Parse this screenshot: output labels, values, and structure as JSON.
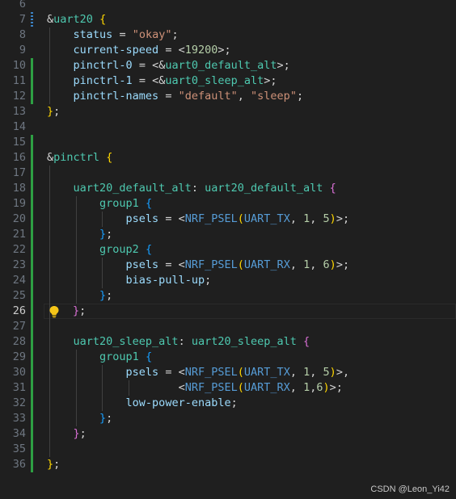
{
  "editor": {
    "active_line": "26",
    "lines": [
      {
        "n": "6",
        "html": ""
      },
      {
        "n": "7",
        "html": "<span class='t-amp'>&amp;</span><span class='t-node'>uart20</span> <span class='t-b1'>{</span>"
      },
      {
        "n": "8",
        "html": "    <span class='t-prop'>status</span> <span class='t-punct'>=</span> <span class='t-str'>\"okay\"</span><span class='t-punct'>;</span>"
      },
      {
        "n": "9",
        "html": "    <span class='t-prop'>current-speed</span> <span class='t-punct'>=</span> <span class='t-punct'>&lt;</span><span class='t-num'>19200</span><span class='t-punct'>&gt;;</span>"
      },
      {
        "n": "10",
        "html": "    <span class='t-prop'>pinctrl-0</span> <span class='t-punct'>= &lt;&amp;</span><span class='t-node'>uart0_default_alt</span><span class='t-punct'>&gt;;</span>"
      },
      {
        "n": "11",
        "html": "    <span class='t-prop'>pinctrl-1</span> <span class='t-punct'>= &lt;&amp;</span><span class='t-node'>uart0_sleep_alt</span><span class='t-punct'>&gt;;</span>"
      },
      {
        "n": "12",
        "html": "    <span class='t-prop'>pinctrl-names</span> <span class='t-punct'>=</span> <span class='t-str'>\"default\"</span><span class='t-punct'>,</span> <span class='t-str'>\"sleep\"</span><span class='t-punct'>;</span>"
      },
      {
        "n": "13",
        "html": "<span class='t-b1'>}</span><span class='t-punct'>;</span>"
      },
      {
        "n": "14",
        "html": ""
      },
      {
        "n": "15",
        "html": ""
      },
      {
        "n": "16",
        "html": "<span class='t-amp'>&amp;</span><span class='t-node'>pinctrl</span> <span class='t-b1'>{</span>"
      },
      {
        "n": "17",
        "html": ""
      },
      {
        "n": "18",
        "html": "    <span class='t-label'>uart20_default_alt</span><span class='t-punct'>:</span> <span class='t-label'>uart20_default_alt</span> <span class='t-b2'>{</span>"
      },
      {
        "n": "19",
        "html": "        <span class='t-label'>group1</span> <span class='t-b3'>{</span>"
      },
      {
        "n": "20",
        "html": "            <span class='t-prop'>psels</span> <span class='t-punct'>=</span> <span class='t-punct'>&lt;</span><span class='t-macro'>NRF_PSEL</span><span class='t-b1'>(</span><span class='t-macro'>UART_TX</span><span class='t-punct'>,</span> <span class='t-num'>1</span><span class='t-punct'>,</span> <span class='t-num'>5</span><span class='t-b1'>)</span><span class='t-punct'>&gt;;</span>"
      },
      {
        "n": "21",
        "html": "        <span class='t-b3'>}</span><span class='t-punct'>;</span>"
      },
      {
        "n": "22",
        "html": "        <span class='t-label'>group2</span> <span class='t-b3'>{</span>"
      },
      {
        "n": "23",
        "html": "            <span class='t-prop'>psels</span> <span class='t-punct'>=</span> <span class='t-punct'>&lt;</span><span class='t-macro'>NRF_PSEL</span><span class='t-b1'>(</span><span class='t-macro'>UART_RX</span><span class='t-punct'>,</span> <span class='t-num'>1</span><span class='t-punct'>,</span> <span class='t-num'>6</span><span class='t-b1'>)</span><span class='t-punct'>&gt;;</span>"
      },
      {
        "n": "24",
        "html": "            <span class='t-prop'>bias-pull-up</span><span class='t-punct'>;</span>"
      },
      {
        "n": "25",
        "html": "        <span class='t-b3'>}</span><span class='t-punct'>;</span>"
      },
      {
        "n": "26",
        "html": "    <span class='t-b2'>}</span><span class='t-punct'>;</span>"
      },
      {
        "n": "27",
        "html": ""
      },
      {
        "n": "28",
        "html": "    <span class='t-label'>uart20_sleep_alt</span><span class='t-punct'>:</span> <span class='t-label'>uart20_sleep_alt</span> <span class='t-b2'>{</span>"
      },
      {
        "n": "29",
        "html": "        <span class='t-label'>group1</span> <span class='t-b3'>{</span>"
      },
      {
        "n": "30",
        "html": "            <span class='t-prop'>psels</span> <span class='t-punct'>=</span> <span class='t-punct'>&lt;</span><span class='t-macro'>NRF_PSEL</span><span class='t-b1'>(</span><span class='t-macro'>UART_TX</span><span class='t-punct'>,</span> <span class='t-num'>1</span><span class='t-punct'>,</span> <span class='t-num'>5</span><span class='t-b1'>)</span><span class='t-punct'>&gt;,</span>"
      },
      {
        "n": "31",
        "html": "                    <span class='t-punct'>&lt;</span><span class='t-macro'>NRF_PSEL</span><span class='t-b1'>(</span><span class='t-macro'>UART_RX</span><span class='t-punct'>,</span> <span class='t-num'>1</span><span class='t-punct'>,</span><span class='t-num'>6</span><span class='t-b1'>)</span><span class='t-punct'>&gt;;</span>"
      },
      {
        "n": "32",
        "html": "            <span class='t-prop'>low-power-enable</span><span class='t-punct'>;</span>"
      },
      {
        "n": "33",
        "html": "        <span class='t-b3'>}</span><span class='t-punct'>;</span>"
      },
      {
        "n": "34",
        "html": "    <span class='t-b2'>}</span><span class='t-punct'>;</span>"
      },
      {
        "n": "35",
        "html": ""
      },
      {
        "n": "36",
        "html": "<span class='t-b1'>}</span><span class='t-punct'>;</span>"
      }
    ]
  },
  "watermark": "CSDN @Leon_Yi42",
  "icons": {
    "lightbulb": "lightbulb-icon"
  },
  "colors": {
    "background": "#1f1f1f",
    "modified_gutter": "#2ea043",
    "added_gutter": "#3b82c4"
  }
}
